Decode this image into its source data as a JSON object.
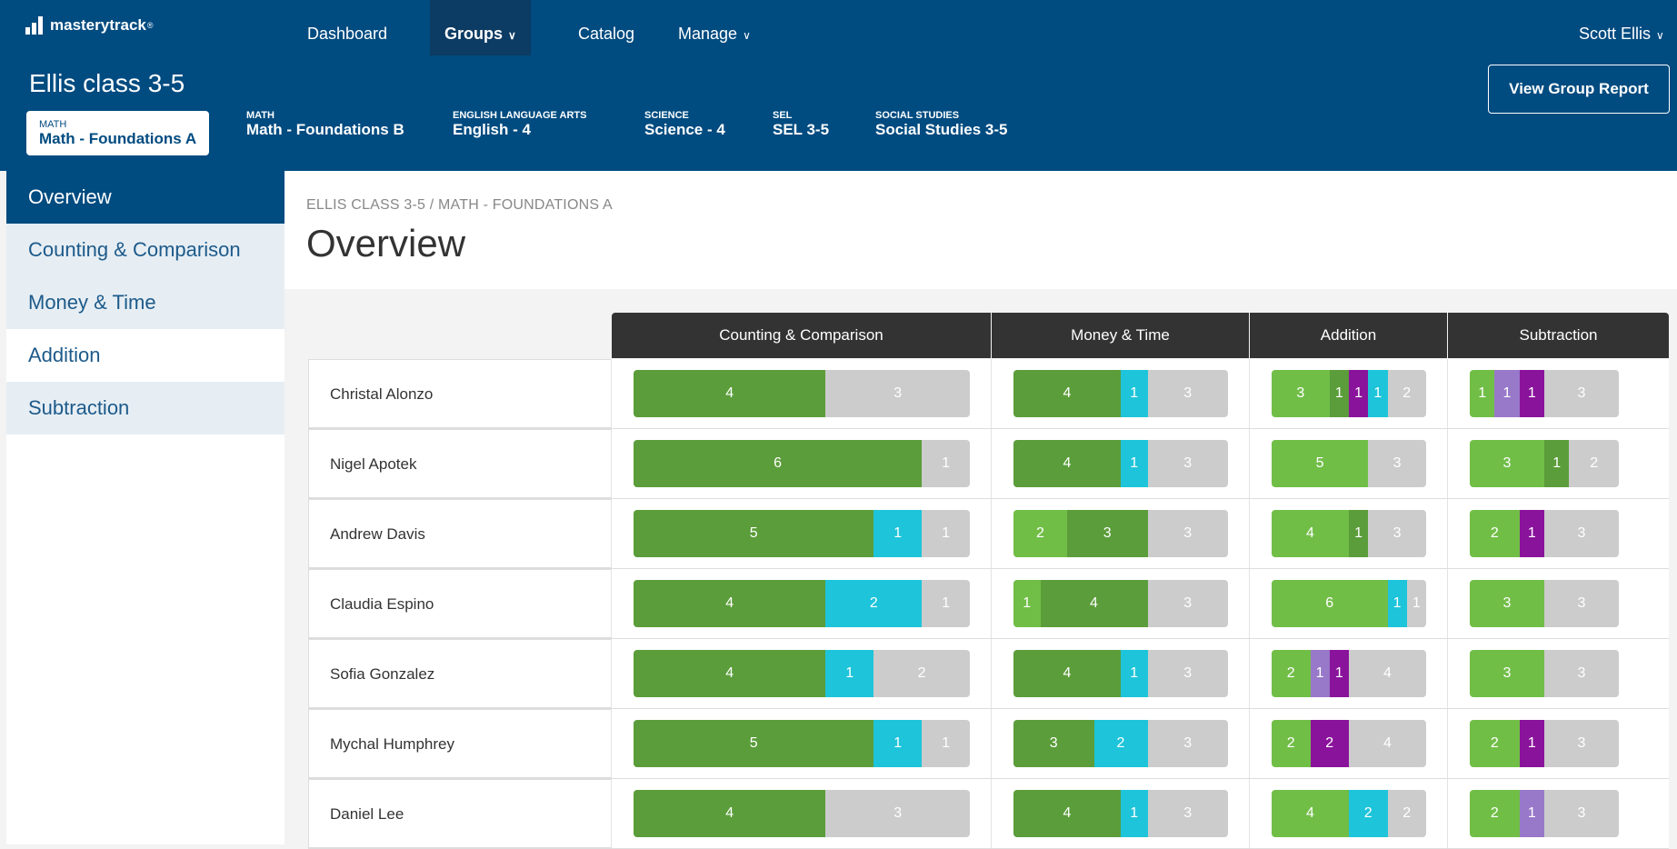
{
  "app": {
    "brand": "masterytrack",
    "registered": "®"
  },
  "nav": {
    "items": [
      {
        "label": "Dashboard",
        "caret": ""
      },
      {
        "label": "Groups",
        "caret": "∨"
      },
      {
        "label": "Catalog",
        "caret": ""
      },
      {
        "label": "Manage",
        "caret": "∨"
      }
    ],
    "user": {
      "label": "Scott Ellis",
      "caret": "∨"
    }
  },
  "group": {
    "title": "Ellis class 3-5",
    "report_button": "View Group Report",
    "tabs": [
      {
        "category": "MATH",
        "name": "Math - Foundations A"
      },
      {
        "category": "MATH",
        "name": "Math - Foundations B"
      },
      {
        "category": "ENGLISH LANGUAGE ARTS",
        "name": "English - 4"
      },
      {
        "category": "SCIENCE",
        "name": "Science - 4"
      },
      {
        "category": "SEL",
        "name": "SEL 3-5"
      },
      {
        "category": "SOCIAL STUDIES",
        "name": "Social Studies 3-5"
      }
    ]
  },
  "sidebar": {
    "items": [
      {
        "label": "Overview"
      },
      {
        "label": "Counting & Comparison"
      },
      {
        "label": "Money & Time"
      },
      {
        "label": "Addition"
      },
      {
        "label": "Subtraction"
      }
    ]
  },
  "main": {
    "breadcrumb": "ELLIS CLASS 3-5 / MATH - FOUNDATIONS A",
    "title": "Overview",
    "columns": [
      "Counting & Comparison",
      "Money & Time",
      "Addition",
      "Subtraction"
    ],
    "status_colors": {
      "green": "#5b9d3a",
      "light-green": "#71be47",
      "cyan": "#1ec4da",
      "purple": "#8a139b",
      "light-purple": "#9878c9",
      "gray": "#cccccc"
    },
    "rows": [
      {
        "name": "Christal Alonzo",
        "cells": [
          [
            [
              "green",
              "4"
            ],
            [
              "gray",
              "3"
            ]
          ],
          [
            [
              "green",
              "4"
            ],
            [
              "cyan",
              "1"
            ],
            [
              "gray",
              "3"
            ]
          ],
          [
            [
              "light-green",
              "3"
            ],
            [
              "green",
              "1"
            ],
            [
              "purple",
              "1"
            ],
            [
              "cyan",
              "1"
            ],
            [
              "gray",
              "2"
            ]
          ],
          [
            [
              "light-green",
              "1"
            ],
            [
              "light-purple",
              "1"
            ],
            [
              "purple",
              "1"
            ],
            [
              "gray",
              "3"
            ]
          ]
        ]
      },
      {
        "name": "Nigel Apotek",
        "cells": [
          [
            [
              "green",
              "6"
            ],
            [
              "gray",
              "1"
            ]
          ],
          [
            [
              "green",
              "4"
            ],
            [
              "cyan",
              "1"
            ],
            [
              "gray",
              "3"
            ]
          ],
          [
            [
              "light-green",
              "5"
            ],
            [
              "gray",
              "3"
            ]
          ],
          [
            [
              "light-green",
              "3"
            ],
            [
              "green",
              "1"
            ],
            [
              "gray",
              "2"
            ]
          ]
        ]
      },
      {
        "name": "Andrew Davis",
        "cells": [
          [
            [
              "green",
              "5"
            ],
            [
              "cyan",
              "1"
            ],
            [
              "gray",
              "1"
            ]
          ],
          [
            [
              "light-green",
              "2"
            ],
            [
              "green",
              "3"
            ],
            [
              "gray",
              "3"
            ]
          ],
          [
            [
              "light-green",
              "4"
            ],
            [
              "green",
              "1"
            ],
            [
              "gray",
              "3"
            ]
          ],
          [
            [
              "light-green",
              "2"
            ],
            [
              "purple",
              "1"
            ],
            [
              "gray",
              "3"
            ]
          ]
        ]
      },
      {
        "name": "Claudia Espino",
        "cells": [
          [
            [
              "green",
              "4"
            ],
            [
              "cyan",
              "2"
            ],
            [
              "gray",
              "1"
            ]
          ],
          [
            [
              "light-green",
              "1"
            ],
            [
              "green",
              "4"
            ],
            [
              "gray",
              "3"
            ]
          ],
          [
            [
              "light-green",
              "6"
            ],
            [
              "cyan",
              "1"
            ],
            [
              "gray",
              "1"
            ]
          ],
          [
            [
              "light-green",
              "3"
            ],
            [
              "gray",
              "3"
            ]
          ]
        ]
      },
      {
        "name": "Sofia Gonzalez",
        "cells": [
          [
            [
              "green",
              "4"
            ],
            [
              "cyan",
              "1"
            ],
            [
              "gray",
              "2"
            ]
          ],
          [
            [
              "green",
              "4"
            ],
            [
              "cyan",
              "1"
            ],
            [
              "gray",
              "3"
            ]
          ],
          [
            [
              "light-green",
              "2"
            ],
            [
              "light-purple",
              "1"
            ],
            [
              "purple",
              "1"
            ],
            [
              "gray",
              "4"
            ]
          ],
          [
            [
              "light-green",
              "3"
            ],
            [
              "gray",
              "3"
            ]
          ]
        ]
      },
      {
        "name": "Mychal Humphrey",
        "cells": [
          [
            [
              "green",
              "5"
            ],
            [
              "cyan",
              "1"
            ],
            [
              "gray",
              "1"
            ]
          ],
          [
            [
              "green",
              "3"
            ],
            [
              "cyan",
              "2"
            ],
            [
              "gray",
              "3"
            ]
          ],
          [
            [
              "light-green",
              "2"
            ],
            [
              "purple",
              "2"
            ],
            [
              "gray",
              "4"
            ]
          ],
          [
            [
              "light-green",
              "2"
            ],
            [
              "purple",
              "1"
            ],
            [
              "gray",
              "3"
            ]
          ]
        ]
      },
      {
        "name": "Daniel Lee",
        "cells": [
          [
            [
              "green",
              "4"
            ],
            [
              "gray",
              "3"
            ]
          ],
          [
            [
              "green",
              "4"
            ],
            [
              "cyan",
              "1"
            ],
            [
              "gray",
              "3"
            ]
          ],
          [
            [
              "light-green",
              "4"
            ],
            [
              "cyan",
              "2"
            ],
            [
              "gray",
              "2"
            ]
          ],
          [
            [
              "light-green",
              "2"
            ],
            [
              "light-purple",
              "1"
            ],
            [
              "gray",
              "3"
            ]
          ]
        ]
      }
    ]
  }
}
